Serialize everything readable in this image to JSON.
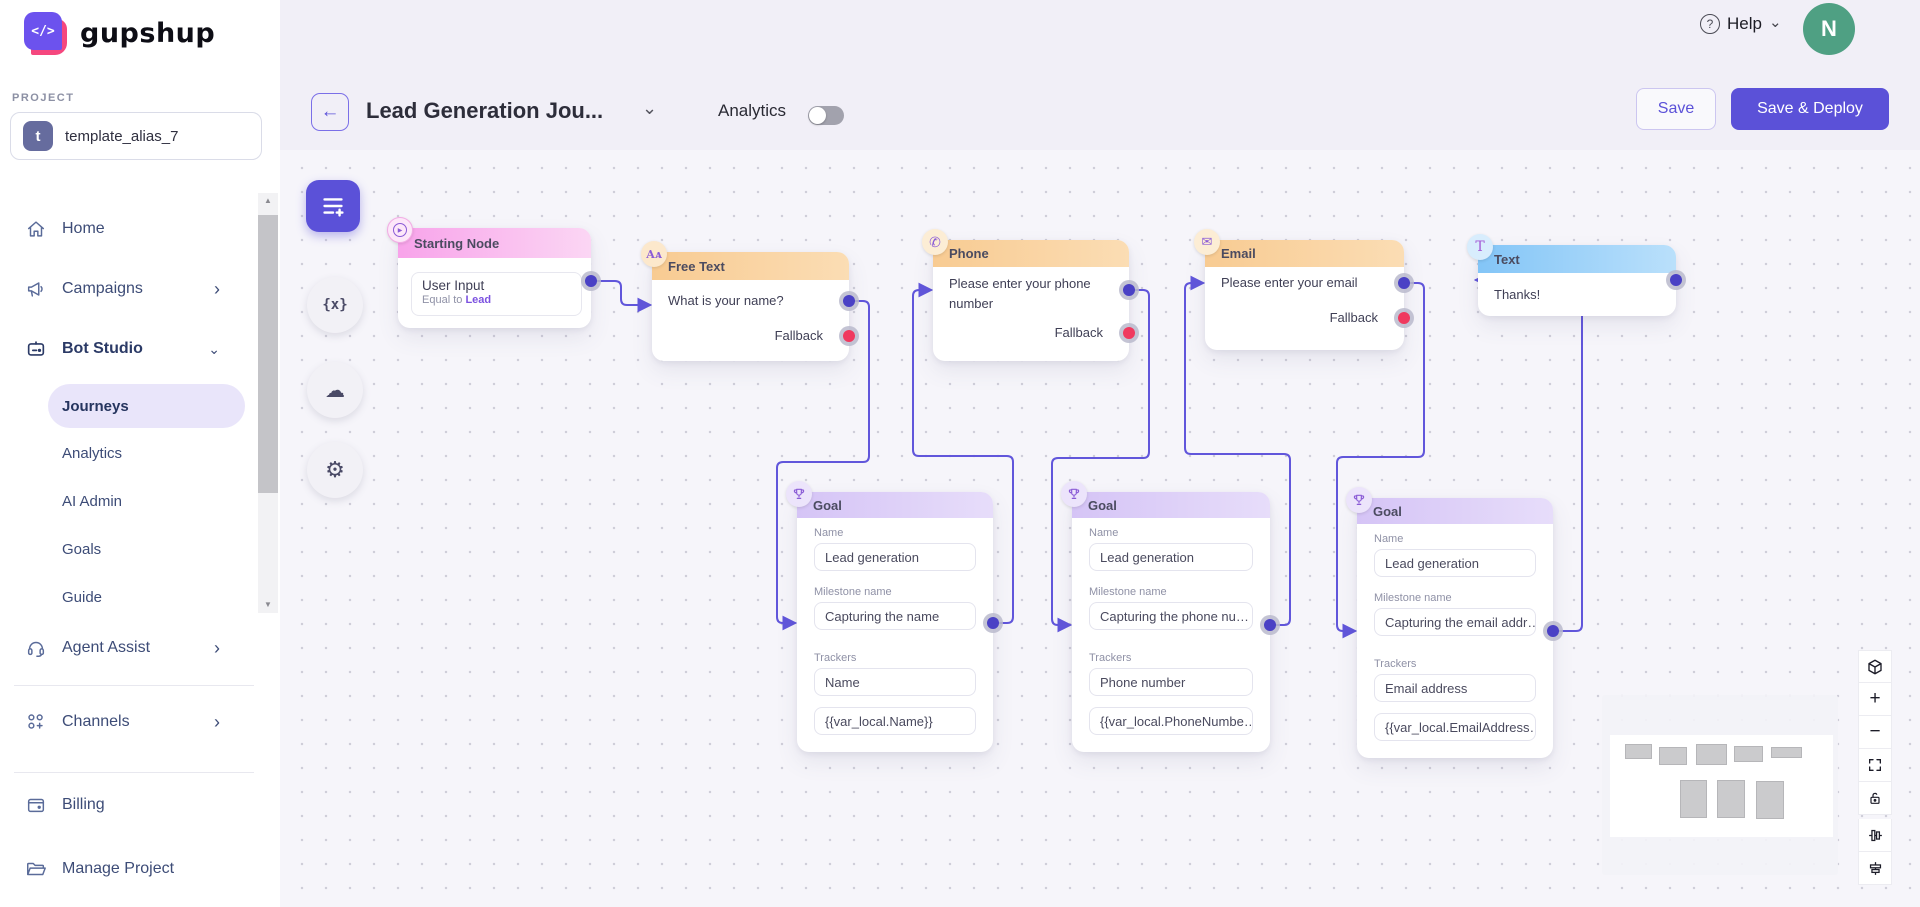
{
  "sidebar": {
    "logo_text": "gupshup",
    "logo_glyph": "</>",
    "project_label": "PROJECT",
    "project": {
      "avatar_letter": "t",
      "name": "template_alias_7"
    },
    "items": {
      "home": "Home",
      "campaigns": "Campaigns",
      "bot_studio": "Bot Studio",
      "agent_assist": "Agent Assist",
      "channels": "Channels",
      "billing": "Billing",
      "manage_project": "Manage Project"
    },
    "bot_studio_sub": {
      "journeys": "Journeys",
      "analytics": "Analytics",
      "ai_admin": "AI Admin",
      "goals": "Goals",
      "guide": "Guide"
    },
    "active_item": "Journeys"
  },
  "header": {
    "title": "Lead Generation Jou...",
    "analytics_toggle_label": "Analytics",
    "analytics_toggle_state": "off",
    "help_label": "Help",
    "avatar_letter": "N",
    "save_label": "Save",
    "deploy_label": "Save & Deploy",
    "back_glyph": "←"
  },
  "canvas": {
    "nodes": {
      "starting": {
        "title": "Starting Node",
        "input_title": "User Input",
        "condition_prefix": "Equal to",
        "condition_value": "Lead"
      },
      "free_text": {
        "title": "Free Text",
        "icon_glyph": "Aᴀ",
        "message": "What is your name?",
        "fallback_label": "Fallback"
      },
      "phone": {
        "title": "Phone",
        "icon_glyph": "✆",
        "message": "Please enter your phone number",
        "fallback_label": "Fallback"
      },
      "email": {
        "title": "Email",
        "icon_glyph": "✉",
        "message": "Please enter your email",
        "fallback_label": "Fallback"
      },
      "text": {
        "title": "Text",
        "icon_glyph": "T",
        "message": "Thanks!"
      }
    },
    "goals": [
      {
        "title": "Goal",
        "name_label": "Name",
        "name": "Lead generation",
        "milestone_label": "Milestone name",
        "milestone": "Capturing the name",
        "trackers_label": "Trackers",
        "tracker": "Name",
        "variable": "{{var_local.Name}}"
      },
      {
        "title": "Goal",
        "name_label": "Name",
        "name": "Lead generation",
        "milestone_label": "Milestone name",
        "milestone": "Capturing the phone nu…",
        "trackers_label": "Trackers",
        "tracker": "Phone number",
        "variable": "{{var_local.PhoneNumbe…"
      },
      {
        "title": "Goal",
        "name_label": "Name",
        "name": "Lead generation",
        "milestone_label": "Milestone name",
        "milestone": "Capturing the email addr…",
        "trackers_label": "Trackers",
        "tracker": "Email address",
        "variable": "{{var_local.EmailAddress…"
      }
    ],
    "toolbar": {
      "variables_glyph": "{x}",
      "cloud_glyph": "☁",
      "settings_glyph": "⚙"
    },
    "controls": {
      "zoom_in": "+",
      "zoom_out": "−"
    }
  },
  "colors": {
    "accent_purple": "#5B51D8",
    "edge_purple": "#6156DB",
    "output_port": "#4A41C5",
    "fallback_port": "#F0395F",
    "avatar_green": "#4FA083",
    "logo_purple": "#6C52EE",
    "logo_pink": "#F5477E",
    "header_pink": "#F8A3EA",
    "header_orange": "#F8CB92",
    "header_goal_purple": "#D5C4F6",
    "header_blue": "#83C5F7"
  }
}
